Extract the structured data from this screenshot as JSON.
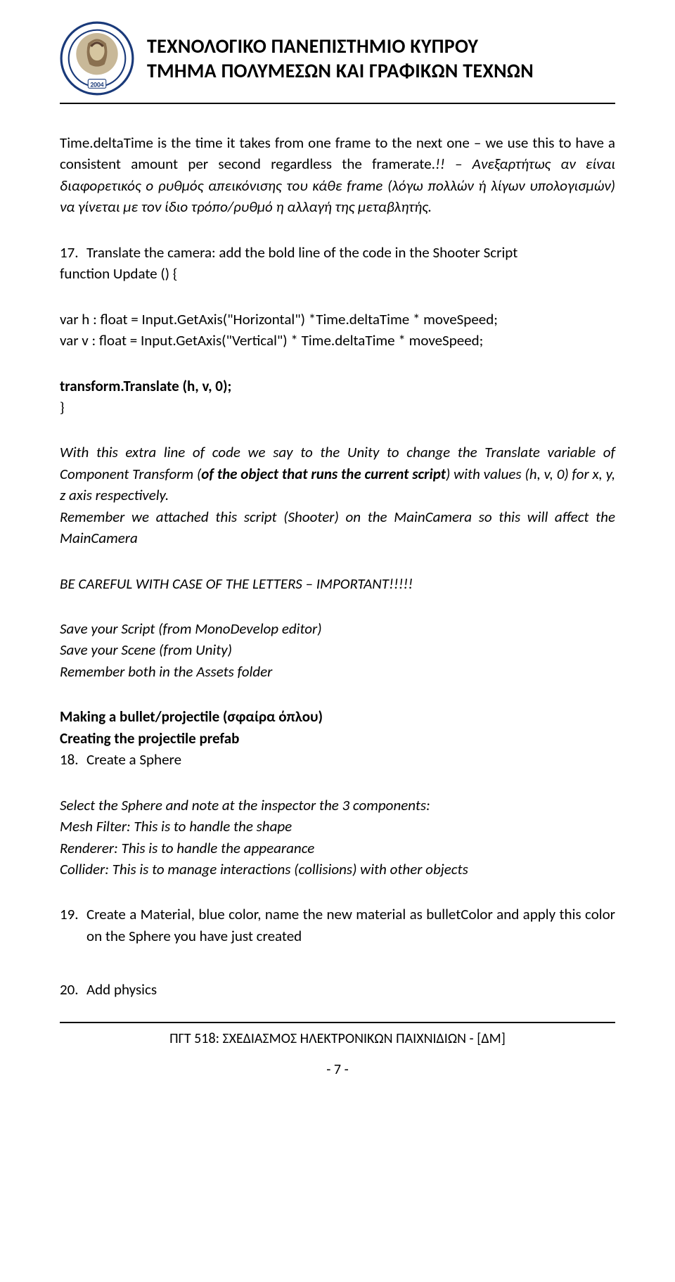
{
  "header": {
    "title_line1": "ΤΕΧΝΟΛΟΓΙΚΟ ΠΑΝΕΠΙΣΤΗΜΙΟ ΚΥΠΡΟΥ",
    "title_line2": "ΤΜΗΜΑ ΠΟΛΥΜΕΣΩΝ ΚΑΙ ΓΡΑΦΙΚΩΝ ΤΕΧΝΩΝ",
    "logo_year": "2004"
  },
  "content": {
    "para1_a": "Time.deltaTime is the time it takes from one frame to the next one – we use this to have a consistent amount per second regardless the framerate.",
    "para1_b": "!! – Ανεξαρτήτως αν είναι διαφορετικός ο ρυθμός απεικόνισης του κάθε frame (λόγω πολλών ή λίγων υπολογισμών) να γίνεται με τον ίδιο τρόπο/ρυθμό η αλλαγή της μεταβλητής.",
    "step17_num": "17.",
    "step17_text": "Translate the camera: add the bold line of the code in the Shooter Script",
    "code_open": "function Update () {",
    "code_l1": "var h : float = Input.GetAxis(\"Horizontal\") *Time.deltaTime * moveSpeed;",
    "code_l2": "var v : float = Input.GetAxis(\"Vertical\") * Time.deltaTime * moveSpeed;",
    "code_bold": "transform.Translate (h, v, 0);",
    "code_close": "}",
    "expl_a": "With this extra line of code we say to the Unity to change the Translate variable of Component Transform (",
    "expl_b": "of the object that runs the current script",
    "expl_c": ") with values (h, v, 0) for x, y, z axis respectively.",
    "expl_d": "Remember we attached this script (Shooter) on the MainCamera so this will affect the MainCamera",
    "warn": "BE CAREFUL WITH CASE OF THE LETTERS – IMPORTANT!!!!!",
    "save1": "Save your Script (from MonoDevelop editor)",
    "save2": "Save your Scene (from Unity)",
    "save3": "Remember both in the Assets folder",
    "sec1": "Making a bullet/projectile (σφαίρα όπλου)",
    "sec2": "Creating the projectile prefab",
    "step18_num": "18.",
    "step18_text": "Create a Sphere",
    "insp1": "Select the Sphere and note at the inspector the 3 components:",
    "insp2": "Mesh Filter: This is to handle the shape",
    "insp3": "Renderer: This is to handle the appearance",
    "insp4": "Collider: This is to manage interactions (collisions) with other objects",
    "step19_num": "19.",
    "step19_text": "Create a Material, blue color, name the new material as bulletColor and apply this color on the Sphere you have just created",
    "step20_num": "20.",
    "step20_text": "Add physics"
  },
  "footer": {
    "text": "ΠΓΤ 518: ΣΧΕΔΙΑΣΜΟΣ ΗΛΕΚΤΡΟΝΙΚΩΝ ΠΑΙΧΝΙΔΙΩΝ - [ΔΜ]",
    "page": "- 7 -"
  }
}
